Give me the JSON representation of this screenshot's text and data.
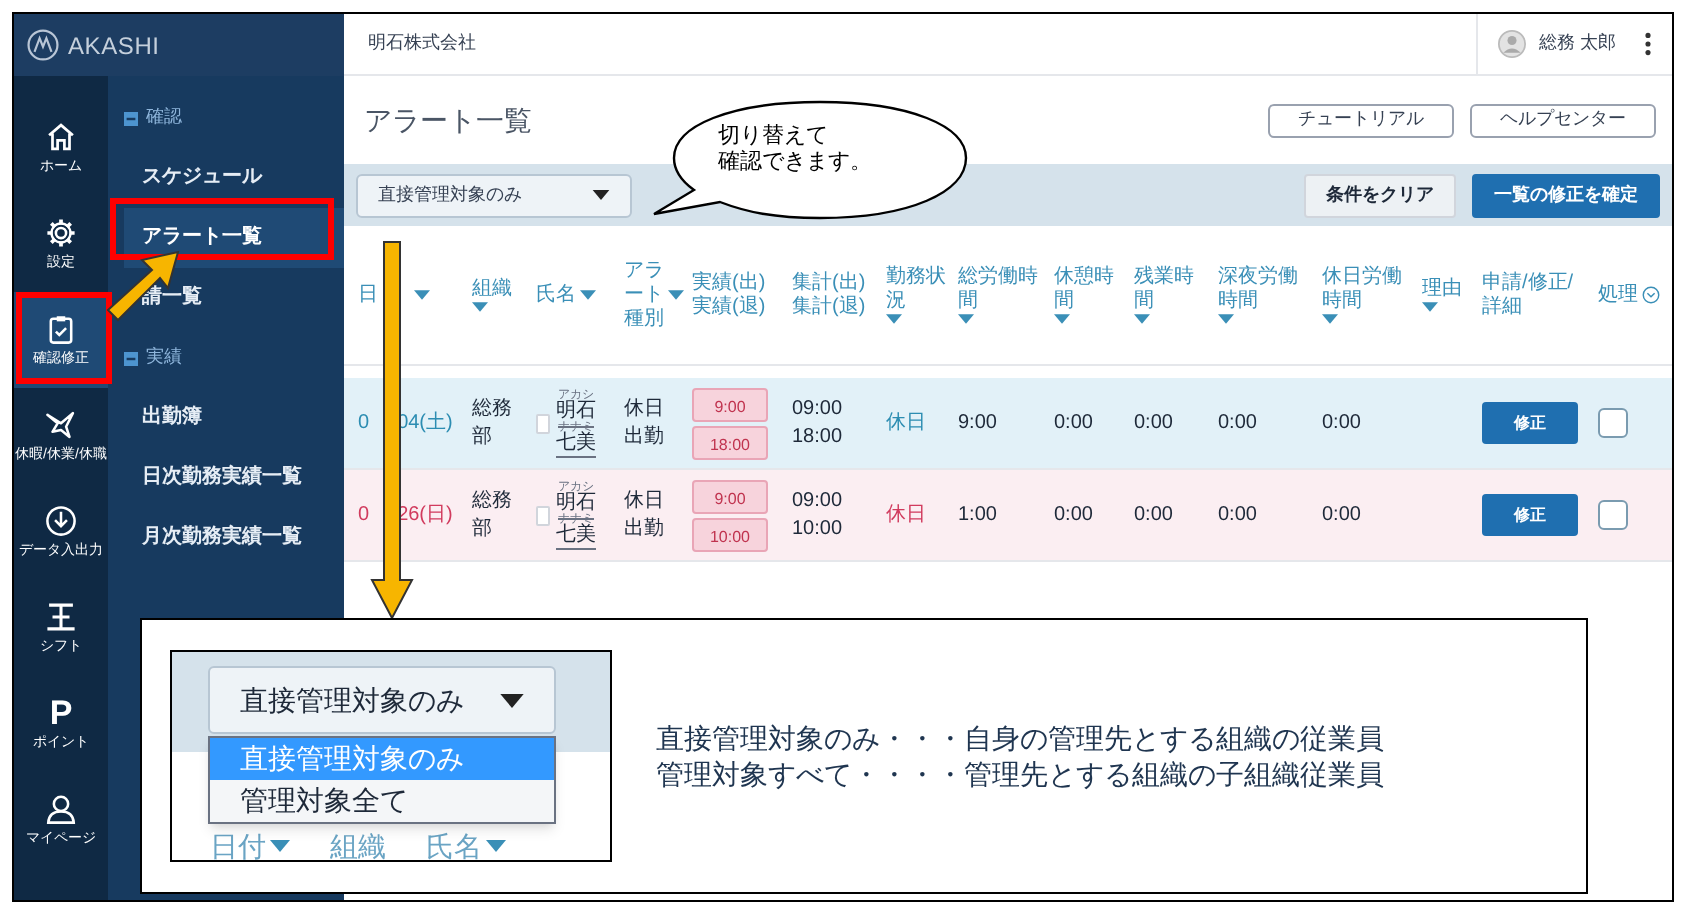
{
  "sidebar": {
    "logo": "AKASHI",
    "rail": [
      {
        "label": "ホーム",
        "selected": false
      },
      {
        "label": "設定",
        "selected": false
      },
      {
        "label": "確認修正",
        "selected": true
      },
      {
        "label": "休暇/休業/休職",
        "selected": false
      },
      {
        "label": "データ入出力",
        "selected": false
      },
      {
        "label": "シフト",
        "selected": false
      },
      {
        "label": "ポイント",
        "glyph": "P",
        "selected": false
      },
      {
        "label": "マイページ",
        "selected": false
      }
    ],
    "sections": [
      {
        "title": "確認",
        "items": [
          {
            "label": "スケジュール",
            "selected": false
          },
          {
            "label": "アラート一覧",
            "selected": true
          },
          {
            "label": "請一覧",
            "selected": false
          }
        ]
      },
      {
        "title": "実績",
        "items": [
          {
            "label": "出勤簿",
            "selected": false
          },
          {
            "label": "日次勤務実績一覧",
            "selected": false
          },
          {
            "label": "月次勤務実績一覧",
            "selected": false
          }
        ]
      }
    ]
  },
  "header": {
    "company": "明石株式会社",
    "user": "総務 太郎"
  },
  "page": {
    "title": "アラート一覧",
    "buttons": [
      "チュートリアル",
      "ヘルプセンター"
    ]
  },
  "toolbar": {
    "filter": "直接管理対象のみ",
    "buttons": [
      {
        "label": "条件をクリア",
        "kind": "plain"
      },
      {
        "label": "一覧の修正を確定",
        "kind": "primary"
      }
    ]
  },
  "table": {
    "columns": [
      {
        "label": "日",
        "sortable": true
      },
      {
        "label": "組織",
        "sortable": true
      },
      {
        "label": "氏名",
        "sortable": true
      },
      {
        "label": "アラート種別",
        "sortable": true
      },
      {
        "label": "実績(出)\n実績(退)",
        "sortable": false
      },
      {
        "label": "集計(出)\n集計(退)",
        "sortable": false
      },
      {
        "label": "勤務状況",
        "sortable": true
      },
      {
        "label": "総労働時間",
        "sortable": true
      },
      {
        "label": "休憩時間",
        "sortable": true
      },
      {
        "label": "残業時間",
        "sortable": true
      },
      {
        "label": "深夜労働時間",
        "sortable": true
      },
      {
        "label": "休日労働時間",
        "sortable": true
      },
      {
        "label": "理由",
        "sortable": true
      },
      {
        "label": "申請/修正/詳細",
        "sortable": false
      },
      {
        "label": "処理",
        "expandable": true
      }
    ],
    "rows": [
      {
        "kind": "saturday",
        "date_prefix": "0",
        "date": "04(土)",
        "org": "総務部",
        "name": {
          "family": "明石",
          "family_kana": "アカシ",
          "given": "七美",
          "given_kana": "ナナミ"
        },
        "selected": false,
        "alert": "休日出勤",
        "actual_in": "9:00",
        "actual_out": "18:00",
        "total_in": "09:00",
        "total_out": "18:00",
        "status": "休日",
        "work": "9:00",
        "break": "0:00",
        "overtime": "0:00",
        "night": "0:00",
        "holiday": "0:00",
        "action": "修正",
        "checked": false
      },
      {
        "kind": "sunday",
        "date_prefix": "0",
        "date": "26(日)",
        "org": "総務部",
        "name": {
          "family": "明石",
          "family_kana": "アカシ",
          "given": "七美",
          "given_kana": "ナナミ"
        },
        "selected": false,
        "alert": "休日出勤",
        "actual_in": "9:00",
        "actual_out": "10:00",
        "total_in": "09:00",
        "total_out": "10:00",
        "status": "休日",
        "work": "1:00",
        "break": "0:00",
        "overtime": "0:00",
        "night": "0:00",
        "holiday": "0:00",
        "action": "修正",
        "checked": false
      }
    ]
  },
  "callout": {
    "lines": [
      "切り替えて",
      "確認できます。"
    ]
  },
  "inset": {
    "filter": "直接管理対象のみ",
    "options": [
      {
        "label": "直接管理対象のみ",
        "selected": true
      },
      {
        "label": "管理対象全て",
        "selected": false
      }
    ],
    "columns": [
      {
        "label": "日付",
        "sortable": true
      },
      {
        "label": "組織",
        "sortable": false
      },
      {
        "label": "氏名",
        "sortable": true
      }
    ],
    "notes": [
      "直接管理対象のみ・・・自身の管理先とする組織の従業員",
      "管理対象すべて・・・・管理先とする組織の子組織従業員"
    ]
  }
}
